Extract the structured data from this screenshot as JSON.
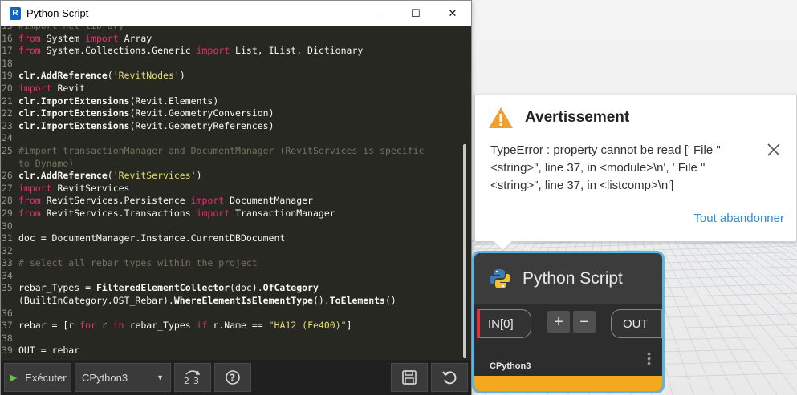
{
  "window": {
    "title": "Python Script",
    "app_icon_letter": "R",
    "minimize": "—",
    "maximize": "☐",
    "close": "✕"
  },
  "code_lines": [
    {
      "n": "15",
      "parts": [
        {
          "t": "#import net library",
          "c": "cm"
        }
      ]
    },
    {
      "n": "16",
      "parts": [
        {
          "t": "from",
          "c": "kw"
        },
        {
          "t": " System "
        },
        {
          "t": "import",
          "c": "kw"
        },
        {
          "t": " Array"
        }
      ]
    },
    {
      "n": "17",
      "parts": [
        {
          "t": "from",
          "c": "kw"
        },
        {
          "t": " System.Collections.Generic "
        },
        {
          "t": "import",
          "c": "kw"
        },
        {
          "t": " List, IList, Dictionary"
        }
      ]
    },
    {
      "n": "18",
      "parts": []
    },
    {
      "n": "19",
      "parts": [
        {
          "t": "clr.AddReference",
          "c": "fn"
        },
        {
          "t": "("
        },
        {
          "t": "'RevitNodes'",
          "c": "str"
        },
        {
          "t": ")"
        }
      ]
    },
    {
      "n": "20",
      "parts": [
        {
          "t": "import",
          "c": "kw"
        },
        {
          "t": " Revit"
        }
      ]
    },
    {
      "n": "21",
      "parts": [
        {
          "t": "clr.ImportExtensions",
          "c": "fn"
        },
        {
          "t": "(Revit.Elements)"
        }
      ]
    },
    {
      "n": "22",
      "parts": [
        {
          "t": "clr.ImportExtensions",
          "c": "fn"
        },
        {
          "t": "(Revit.GeometryConversion)"
        }
      ]
    },
    {
      "n": "23",
      "parts": [
        {
          "t": "clr.ImportExtensions",
          "c": "fn"
        },
        {
          "t": "(Revit.GeometryReferences)"
        }
      ]
    },
    {
      "n": "24",
      "parts": []
    },
    {
      "n": "25",
      "parts": [
        {
          "t": "#import transactionManager and DocumentManager (RevitServices is specific",
          "c": "cm"
        }
      ]
    },
    {
      "n": "",
      "parts": [
        {
          "t": "to Dynamo)",
          "c": "cm"
        }
      ]
    },
    {
      "n": "26",
      "parts": [
        {
          "t": "clr.AddReference",
          "c": "fn"
        },
        {
          "t": "("
        },
        {
          "t": "'RevitServices'",
          "c": "str"
        },
        {
          "t": ")"
        }
      ]
    },
    {
      "n": "27",
      "parts": [
        {
          "t": "import",
          "c": "kw"
        },
        {
          "t": " RevitServices"
        }
      ]
    },
    {
      "n": "28",
      "parts": [
        {
          "t": "from",
          "c": "kw"
        },
        {
          "t": " RevitServices.Persistence "
        },
        {
          "t": "import",
          "c": "kw"
        },
        {
          "t": " DocumentManager"
        }
      ]
    },
    {
      "n": "29",
      "parts": [
        {
          "t": "from",
          "c": "kw"
        },
        {
          "t": " RevitServices.Transactions "
        },
        {
          "t": "import",
          "c": "kw"
        },
        {
          "t": " TransactionManager"
        }
      ]
    },
    {
      "n": "30",
      "parts": []
    },
    {
      "n": "31",
      "parts": [
        {
          "t": "doc = DocumentManager.Instance.CurrentDBDocument"
        }
      ]
    },
    {
      "n": "32",
      "parts": []
    },
    {
      "n": "33",
      "parts": [
        {
          "t": "# select all rebar types within the project",
          "c": "cm"
        }
      ]
    },
    {
      "n": "34",
      "parts": []
    },
    {
      "n": "35",
      "parts": [
        {
          "t": "rebar_Types = "
        },
        {
          "t": "FilteredElementCollector",
          "c": "fn"
        },
        {
          "t": "(doc)."
        },
        {
          "t": "OfCategory",
          "c": "fn"
        }
      ]
    },
    {
      "n": "",
      "parts": [
        {
          "t": "(BuiltInCategory.OST_Rebar)."
        },
        {
          "t": "WhereElementIsElementType",
          "c": "fn"
        },
        {
          "t": "()."
        },
        {
          "t": "ToElements",
          "c": "fn"
        },
        {
          "t": "()"
        }
      ]
    },
    {
      "n": "36",
      "parts": []
    },
    {
      "n": "37",
      "parts": [
        {
          "t": "rebar = [r "
        },
        {
          "t": "for",
          "c": "kw"
        },
        {
          "t": " r "
        },
        {
          "t": "in",
          "c": "kw"
        },
        {
          "t": " rebar_Types "
        },
        {
          "t": "if",
          "c": "kw"
        },
        {
          "t": " r.Name == "
        },
        {
          "t": "\"HA12 (Fe400)\"",
          "c": "str"
        },
        {
          "t": "]"
        }
      ]
    },
    {
      "n": "38",
      "parts": []
    },
    {
      "n": "39",
      "parts": [
        {
          "t": "OUT = rebar"
        }
      ]
    }
  ],
  "toolbar": {
    "run_label": "Exécuter",
    "engine_value": "CPython3"
  },
  "warning": {
    "title": "Avertissement",
    "message": "TypeError : property cannot be read ['  File \"<string>\", line 37, in <module>\\n', '  File \"<string>\", line 37, in <listcomp>\\n']",
    "dismiss_all": "Tout abandonner"
  },
  "node": {
    "title": "Python Script",
    "input_port": "IN[0]",
    "add_port": "+",
    "remove_port": "−",
    "output_port": "OUT",
    "engine": "CPython3"
  }
}
